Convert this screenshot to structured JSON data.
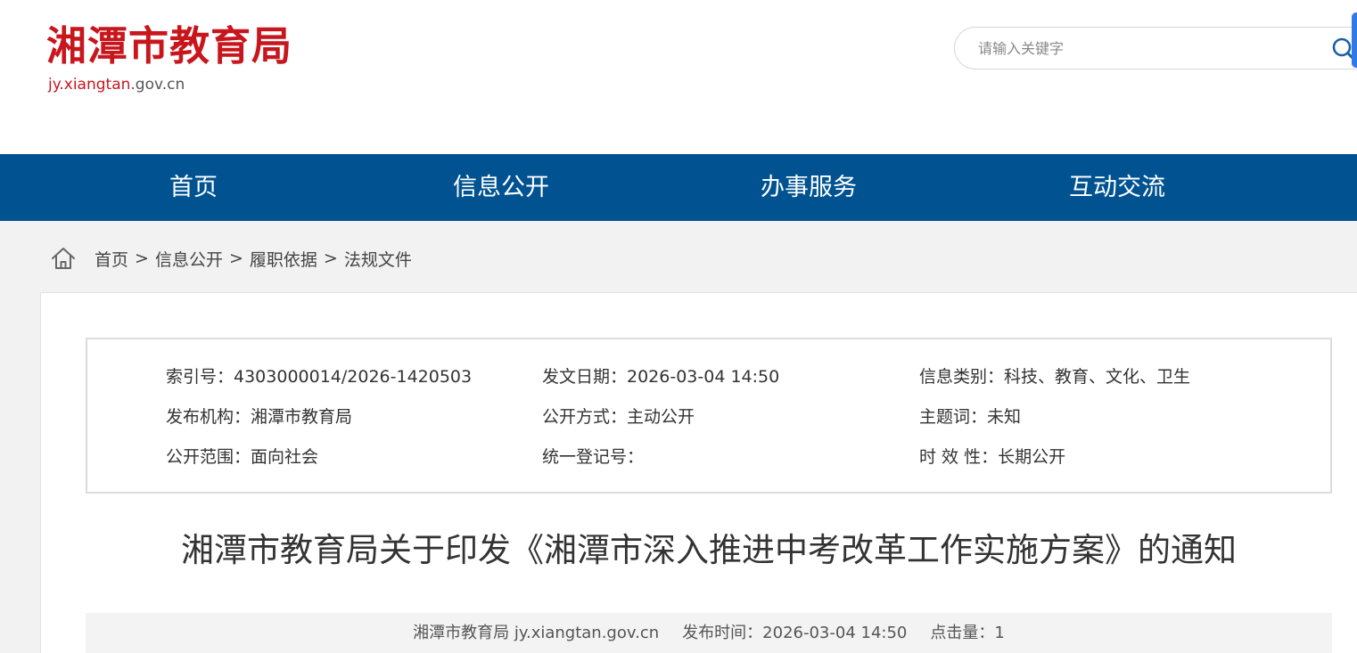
{
  "header": {
    "logo_title": "湘潭市教育局",
    "logo_domain_main": "jy.xiangtan",
    "logo_domain_suffix": ".gov.cn",
    "search_placeholder": "请输入关键字",
    "brand_color": "#c8161d"
  },
  "nav": {
    "color": "#005291",
    "items": [
      {
        "label": "首页"
      },
      {
        "label": "信息公开"
      },
      {
        "label": "办事服务"
      },
      {
        "label": "互动交流"
      }
    ]
  },
  "breadcrumb": {
    "items": [
      "首页",
      "信息公开",
      "履职依据",
      "法规文件"
    ],
    "separator": ">"
  },
  "meta": {
    "index_no": "索引号：4303000014/2026-1420503",
    "issue_date": "发文日期：2026-03-04 14:50",
    "category": "信息类别：科技、教育、文化、卫生",
    "publisher": "发布机构：湘潭市教育局",
    "disclosure_method": "公开方式：主动公开",
    "subject": "主题词：未知",
    "disclosure_scope": "公开范围：面向社会",
    "registration_no": "统一登记号：",
    "validity": "时 效 性：长期公开"
  },
  "article": {
    "title": "湘潭市教育局关于印发《湘潭市深入推进中考改革工作实施方案》的通知",
    "source": "湘潭市教育局 jy.xiangtan.gov.cn",
    "publish_time": "发布时间：2026-03-04 14:50",
    "clicks": "点击量：1"
  }
}
